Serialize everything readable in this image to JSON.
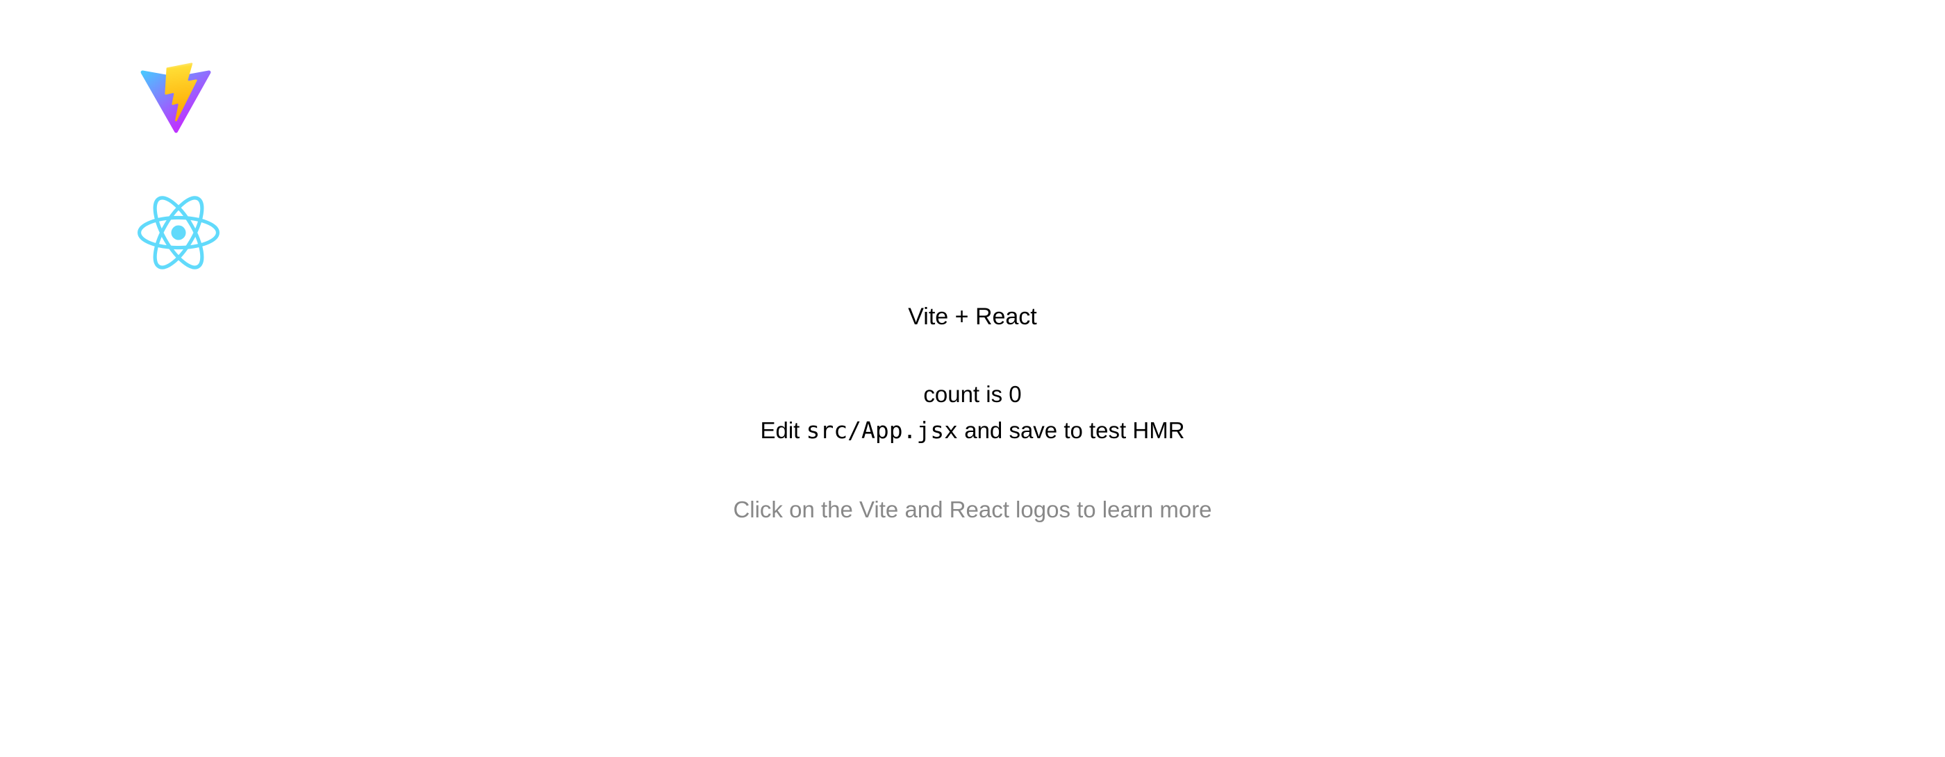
{
  "logos": {
    "vite": {
      "icon": "vite-logo-icon",
      "alt": "Vite logo"
    },
    "react": {
      "icon": "react-logo-icon",
      "alt": "React logo",
      "color": "#61dafb"
    }
  },
  "title": "Vite + React",
  "card": {
    "count_label": "count is 0",
    "edit_prefix": "Edit ",
    "edit_code": "src/App.jsx",
    "edit_suffix": " and save to test HMR"
  },
  "footer_text": "Click on the Vite and React logos to learn more",
  "colors": {
    "muted_text": "#888888",
    "react_blue": "#61dafb"
  }
}
